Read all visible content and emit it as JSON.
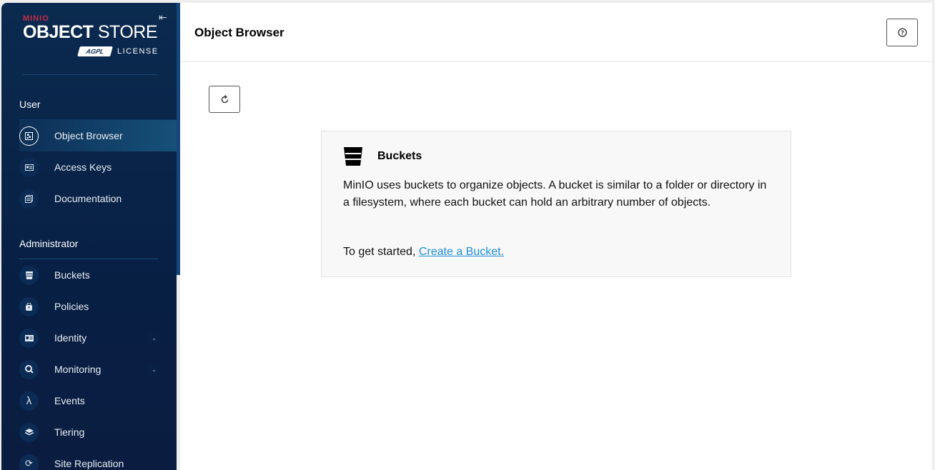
{
  "logo": {
    "brand": "MINIO",
    "product_bold": "OBJECT",
    "product_light": "STORE",
    "badge": "AGPL",
    "license": "LICENSE"
  },
  "sidebar": {
    "user_section": "User",
    "user_items": [
      {
        "label": "Object Browser",
        "icon": "object-browser-icon"
      },
      {
        "label": "Access Keys",
        "icon": "key-icon"
      },
      {
        "label": "Documentation",
        "icon": "documentation-icon"
      }
    ],
    "admin_section": "Administrator",
    "admin_items": [
      {
        "label": "Buckets",
        "icon": "bucket-icon"
      },
      {
        "label": "Policies",
        "icon": "policy-icon"
      },
      {
        "label": "Identity",
        "icon": "identity-icon",
        "expandable": true
      },
      {
        "label": "Monitoring",
        "icon": "monitoring-icon",
        "expandable": true
      },
      {
        "label": "Events",
        "icon": "lambda-icon"
      },
      {
        "label": "Tiering",
        "icon": "layers-icon"
      },
      {
        "label": "Site Replication",
        "icon": "replication-icon"
      }
    ],
    "active": "Object Browser"
  },
  "header": {
    "title": "Object Browser"
  },
  "card": {
    "title": "Buckets",
    "text": "MinIO uses buckets to organize objects. A bucket is similar to a folder or directory in a filesystem, where each bucket can hold an arbitrary number of objects.",
    "start_prefix": "To get started, ",
    "start_link": "Create a Bucket."
  },
  "colors": {
    "sidebar": "#0b2a4f",
    "active_item": "#165079",
    "link": "#1f8fd8",
    "brand": "#c72c48"
  }
}
